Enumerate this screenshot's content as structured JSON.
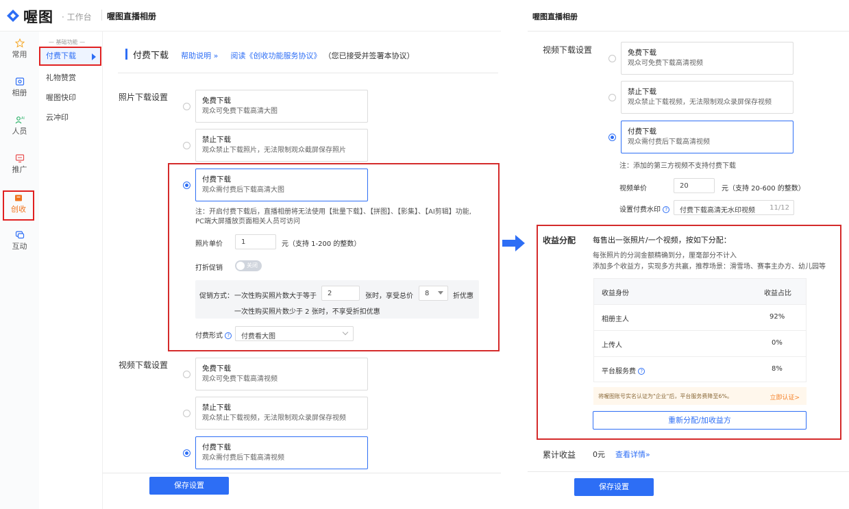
{
  "brand": {
    "logo_text": "喔图",
    "workspace": "· 工作台",
    "album_title": "喔图直播相册"
  },
  "rail": [
    {
      "label": "常用",
      "icon": "star-icon"
    },
    {
      "label": "相册",
      "icon": "album-icon"
    },
    {
      "label": "人员",
      "icon": "people-icon"
    },
    {
      "label": "推广",
      "icon": "promote-icon"
    },
    {
      "label": "创收",
      "icon": "revenue-icon"
    },
    {
      "label": "互动",
      "icon": "interact-icon"
    }
  ],
  "submenu": {
    "section": "— 基础功能 —",
    "items": [
      "付费下载",
      "礼物赞赏",
      "喔图快印",
      "云冲印"
    ]
  },
  "main": {
    "title": "付费下载",
    "help_link": "帮助说明 »",
    "agreement_link": "阅读《创收功能服务协议》",
    "agreement_suffix": "（您已接受并签署本协议）",
    "photo_section_label": "照片下载设置",
    "photo_options": [
      {
        "title": "免费下载",
        "desc": "观众可免费下载高清大图"
      },
      {
        "title": "禁止下载",
        "desc": "观众禁止下载照片，无法限制观众截屏保存照片"
      },
      {
        "title": "付费下载",
        "desc": "观众需付费后下载高清大图"
      }
    ],
    "photo_note_line1": "注：开启付费下载后，直播相册将无法使用【批量下载】、【拼图】、【影集】、【AI剪辑】功能,",
    "photo_note_line2": "PC端大屏播放页面相关人员可访问",
    "price_label": "照片单价",
    "price_value": "1",
    "price_unit": "元（支持 1-200 的整数）",
    "discount_label": "打折促销",
    "discount_toggle": "关闭",
    "promo_label": "促销方式：",
    "promo_text1": "一次性购买照片数大于等于",
    "promo_count": "2",
    "promo_text2": "张时，享受总价",
    "promo_discount": "8",
    "promo_text3": "折优惠",
    "promo_note": "一次性购买照片数少于 2 张时，不享受折扣优惠",
    "pay_form_label": "付费形式",
    "pay_form_value": "付费看大图",
    "video_section_label": "视频下载设置",
    "video_options": [
      {
        "title": "免费下载",
        "desc": "观众可免费下载高清视频"
      },
      {
        "title": "禁止下载",
        "desc": "观众禁止下载视频，无法限制观众录屏保存视频"
      },
      {
        "title": "付费下载",
        "desc": "观众需付费后下载高清视频"
      }
    ],
    "save_button": "保存设置"
  },
  "right": {
    "title": "喔图直播相册",
    "video_section_label": "视频下载设置",
    "video_options": [
      {
        "title": "免费下载",
        "desc": "观众可免费下载高清视频"
      },
      {
        "title": "禁止下载",
        "desc": "观众禁止下载视频，无法限制观众录屏保存视频"
      },
      {
        "title": "付费下载",
        "desc": "观众需付费后下载高清视频"
      }
    ],
    "video_note": "注：添加的第三方视频不支持付费下载",
    "video_price_label": "视频单价",
    "video_price_value": "20",
    "video_price_unit": "元（支持 20-600 的整数）",
    "watermark_label": "设置付费水印",
    "watermark_value": "付费下载高清无水印视频",
    "watermark_count": "11/12",
    "revenue_label": "收益分配",
    "revenue_heading": "每售出一张照片/一个视频，按如下分配：",
    "revenue_line1": "每张照片的分润金额精确到分，厘毫部分不计入",
    "revenue_line2": "添加多个收益方，实现多方共赢，推荐场景：滑雪场、赛事主办方、幼儿园等",
    "table_headers": [
      "收益身份",
      "收益占比"
    ],
    "table_rows": [
      {
        "role": "相册主人",
        "share": "92%"
      },
      {
        "role": "上传人",
        "share": "0%"
      },
      {
        "role": "平台服务费",
        "share": "8%"
      }
    ],
    "notice_text": "将喔图账号实名认证为\"企业\"后，平台服务费降至6%。",
    "notice_link": "立即认证>",
    "redistribute_button": "重新分配/加收益方",
    "total_label": "累计收益",
    "total_value": "0元",
    "total_link": "查看详情»",
    "save_button": "保存设置"
  },
  "colors": {
    "accent": "#2d6ef5",
    "highlight": "#d42a2a",
    "revenue_active": "#f0741e"
  }
}
